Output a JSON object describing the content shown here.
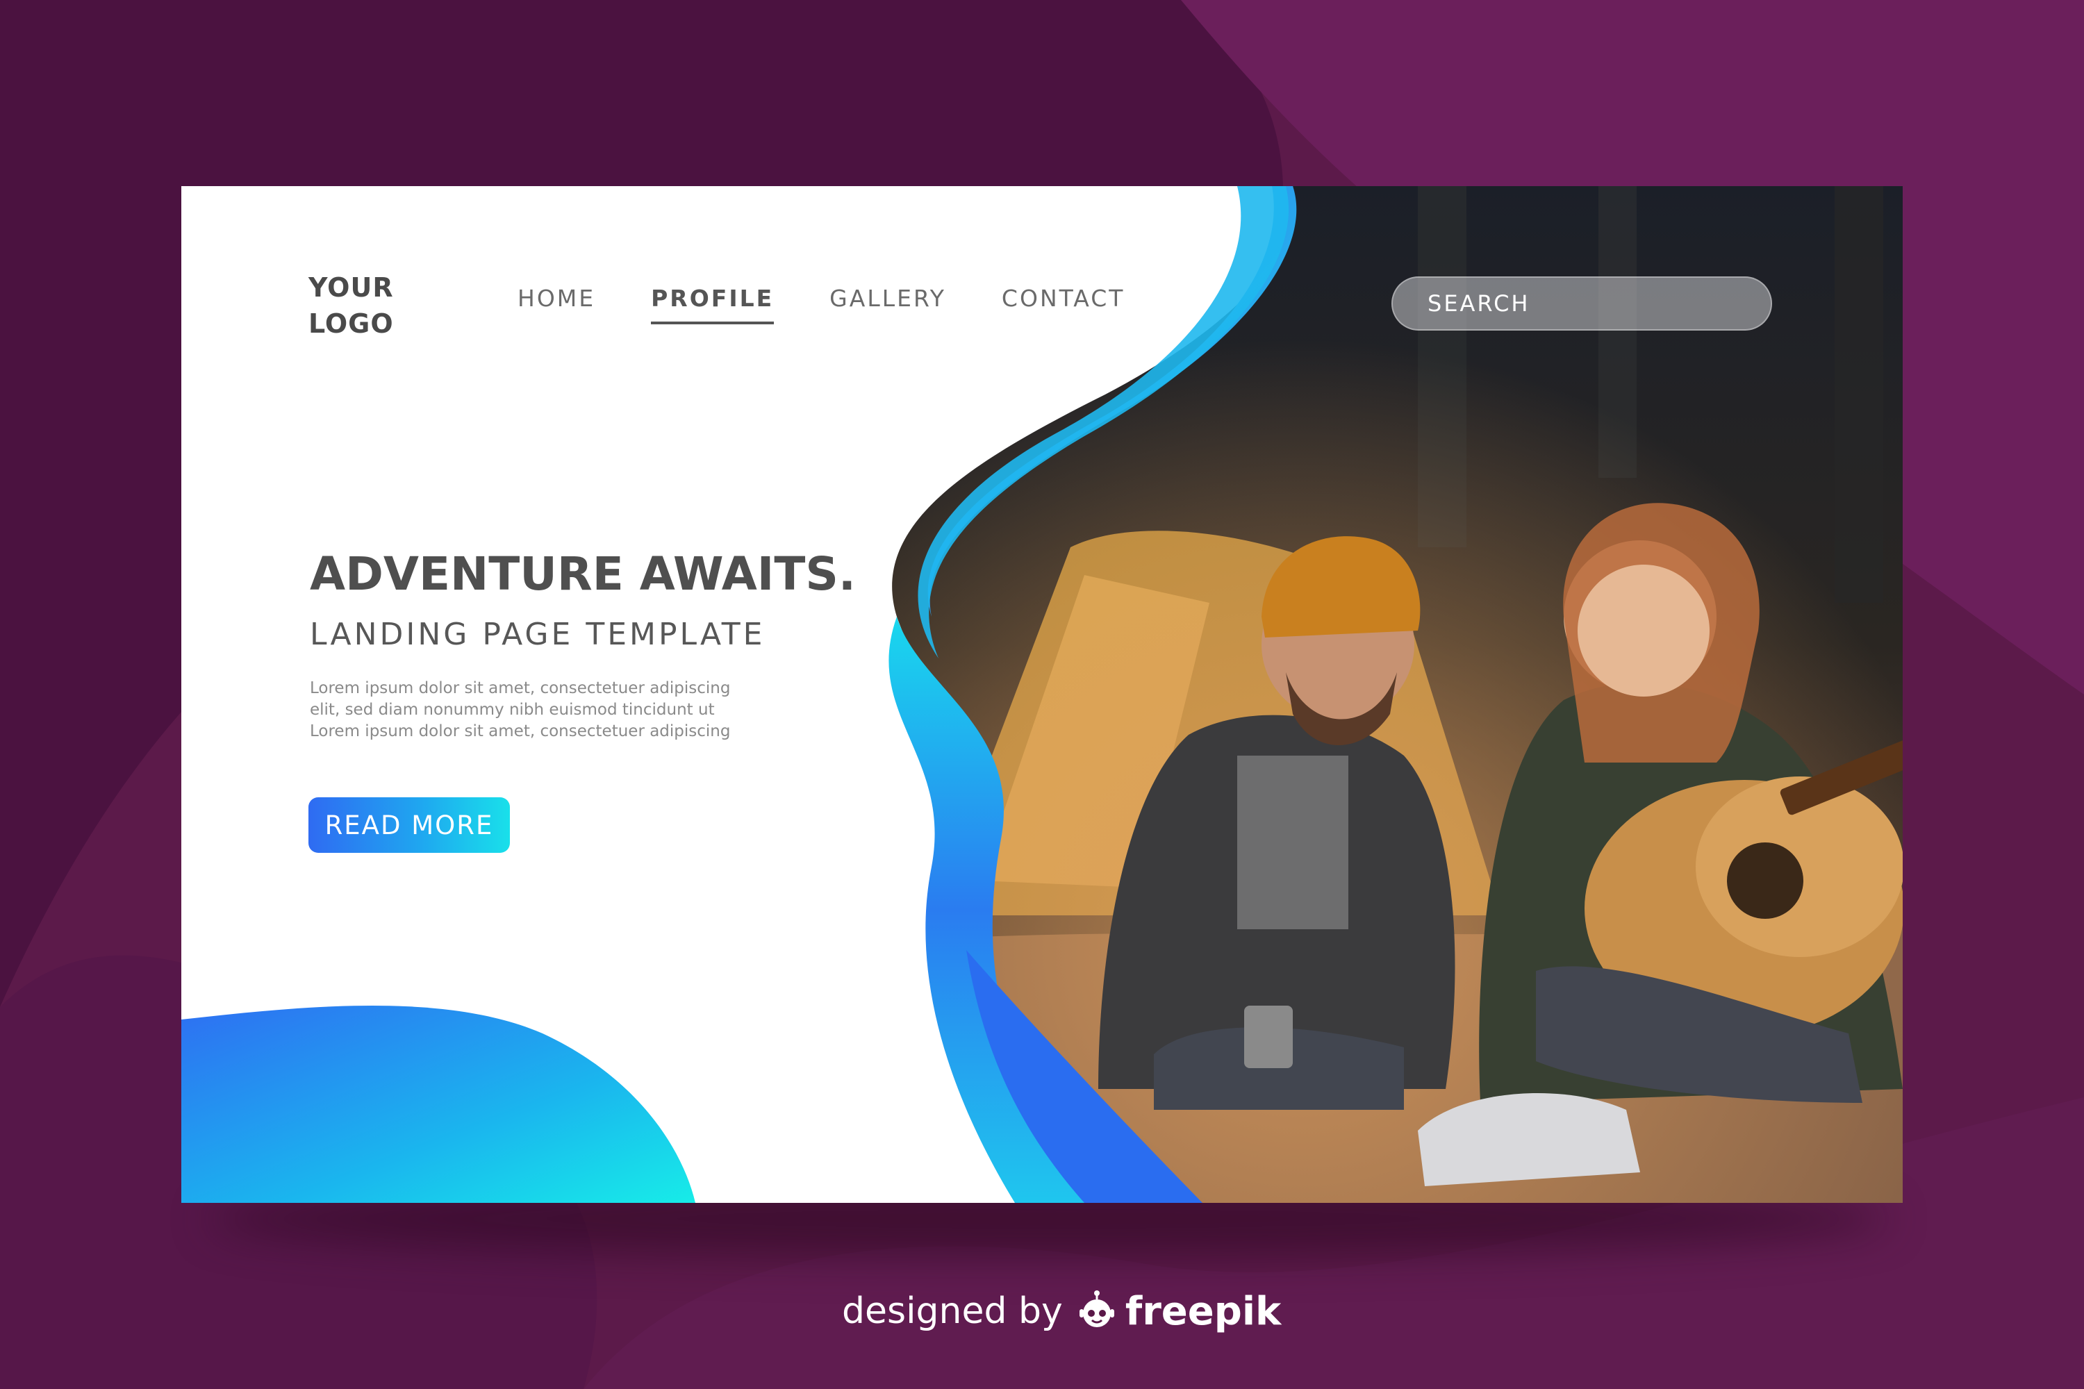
{
  "logo": {
    "text": "YOUR\nLOGO"
  },
  "nav": {
    "items": [
      {
        "label": "HOME",
        "active": false
      },
      {
        "label": "PROFILE",
        "active": true
      },
      {
        "label": "GALLERY",
        "active": false
      },
      {
        "label": "CONTACT",
        "active": false
      }
    ]
  },
  "search": {
    "placeholder": "SEARCH"
  },
  "hero": {
    "headline": "ADVENTURE AWAITS.",
    "subheadline": "LANDING PAGE TEMPLATE",
    "body_lines": [
      "Lorem ipsum dolor sit amet, consectetuer adipiscing",
      "elit, sed diam nonummy nibh euismod tincidunt ut",
      "Lorem ipsum dolor sit amet, consectetuer adipiscing"
    ],
    "cta_label": "READ MORE"
  },
  "credit": {
    "prefix": "designed by",
    "brand": "freepik"
  },
  "colors": {
    "background": "#5a1848",
    "background_light": "#6b2058",
    "background_dark": "#4a1238",
    "text_dark": "#4f4f4f",
    "accent_blue": "#2f6bf2",
    "accent_cyan": "#19e0ea"
  },
  "icons": {
    "credit_logo": "freepik-robot-icon"
  }
}
